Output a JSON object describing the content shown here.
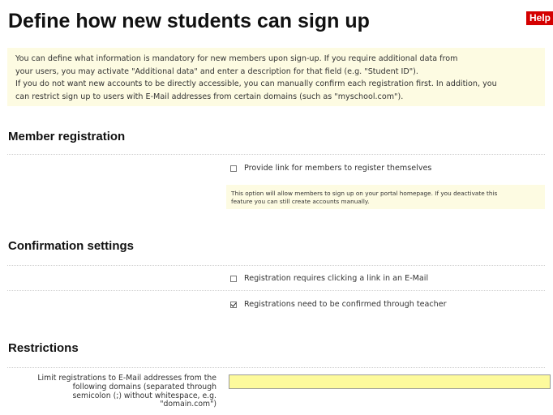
{
  "header": {
    "title": "Define how new students can sign up",
    "help_label": "Help"
  },
  "intro": {
    "lines": [
      "You can define what information is mandatory for new members upon sign-up. If you require additional data from",
      "your users, you may activate \"Additional data\" and enter a description for that field (e.g. \"Student ID\").",
      "If you do not want new accounts to be directly accessible, you can manually confirm each registration first. In addition, you",
      "can restrict sign up to users with E-Mail addresses from certain domains (such as \"myschool.com\")."
    ]
  },
  "member_registration": {
    "heading": "Member registration",
    "self_register": {
      "label": "Provide link for members to register themselves",
      "checked": false
    },
    "note_lines": [
      "This option will allow members to sign up on your portal homepage. If you deactivate this",
      "feature you can still create accounts manually."
    ]
  },
  "confirmation": {
    "heading": "Confirmation settings",
    "email_link": {
      "label": "Registration requires clicking a link in an E-Mail",
      "checked": false
    },
    "teacher_confirm": {
      "label": "Registrations need to be confirmed through teacher",
      "checked": true
    }
  },
  "restrictions": {
    "heading": "Restrictions",
    "domains_label_lines": [
      "Limit registrations to E-Mail addresses from the",
      "following domains (separated through",
      "semicolon (;) without whitespace, e.g.",
      "\"domain.com\")"
    ],
    "domains_value": ""
  }
}
